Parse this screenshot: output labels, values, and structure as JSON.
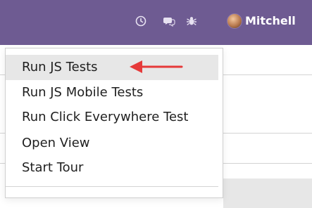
{
  "header": {
    "username": "Mitchell"
  },
  "icons": {
    "clock": "clock-icon",
    "chat": "chat-icon",
    "bug": "bug-icon",
    "avatar": "avatar-photo"
  },
  "menu": {
    "items": [
      "Run JS Tests",
      "Run JS Mobile Tests",
      "Run Click Everywhere Test",
      "Open View",
      "Start Tour"
    ],
    "active_index": 0
  },
  "colors": {
    "navbar": "#6e5b92",
    "active_item": "#e7e7e7",
    "arrow": "#e63a3a"
  }
}
